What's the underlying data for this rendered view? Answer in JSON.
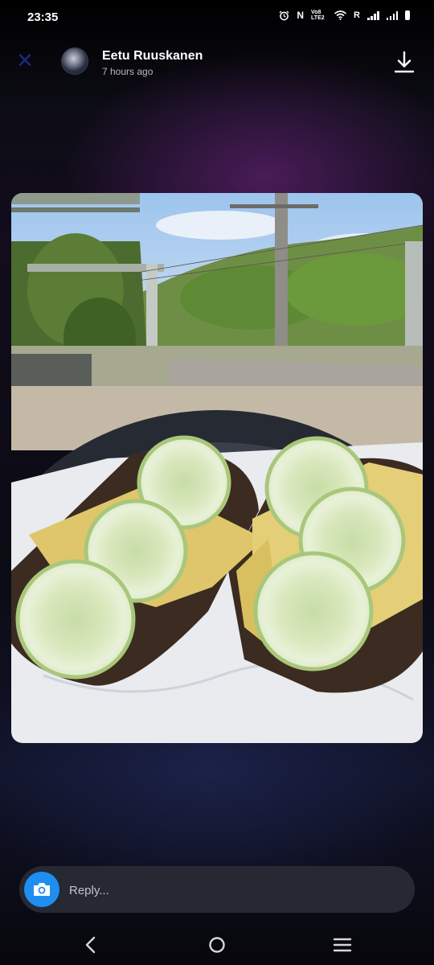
{
  "status_bar": {
    "time": "23:35",
    "indicators": [
      "alarm-icon",
      "nfc-icon",
      "volte-icon",
      "wifi-icon",
      "roaming-icon",
      "signal-icon",
      "signal-icon",
      "battery-icon"
    ],
    "nfc_label": "N",
    "volte_label": "Vo8 LTE2",
    "roaming_label": "R"
  },
  "header": {
    "username": "Eetu Ruuskanen",
    "timestamp": "7 hours ago",
    "close_icon": "close-icon",
    "download_icon": "download-icon"
  },
  "story": {
    "image_subject": "open-faced rye bread sandwiches with cheese and cucumber slices on a plate outdoors"
  },
  "reply": {
    "placeholder": "Reply...",
    "camera_icon": "camera-icon"
  },
  "nav": {
    "back_icon": "back-icon",
    "home_icon": "home-icon",
    "recents_icon": "recents-icon"
  },
  "colors": {
    "accent": "#1e8ff0",
    "background": "#0c0c12",
    "reply_bar": "#262833"
  }
}
